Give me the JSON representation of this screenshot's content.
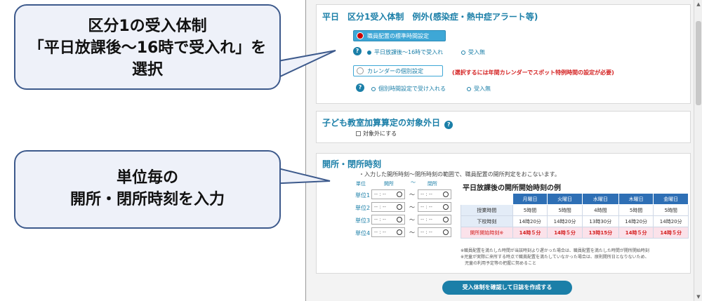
{
  "callouts": [
    {
      "lines": [
        "区分1の受入体制",
        "「平日放課後～16時で受入れ」を",
        "選択"
      ]
    },
    {
      "lines": [
        "単位毎の",
        "開所・閉所時刻を入力"
      ]
    }
  ],
  "panel1": {
    "title": "平日　区分1受入体制　例外(感染症・熱中症アラート等)",
    "standard_button": "職員配置の標準時間設定",
    "standard_options": [
      "平日放課後～16時で受入れ",
      "受入無"
    ],
    "standard_selected": 0,
    "calendar_button": "カレンダーの個別設定",
    "warning": "(選択するには年間カレンダーでスポット特例時間の設定が必要)",
    "calendar_options": [
      "個別時間設定で受け入れる",
      "受入無"
    ],
    "help": "?"
  },
  "panel2": {
    "title": "子ども教室加算算定の対象外日",
    "help": "?",
    "checkbox_label": "対象外にする"
  },
  "panel3": {
    "title": "開所・閉所時刻",
    "note": "・入力した開所時刻～閉所時刻の範囲で、職員配置の開所判定をおこないます。",
    "head_unit": "単位",
    "head_open": "開所",
    "head_sep": "～",
    "head_close": "閉所",
    "units": [
      "単位1",
      "単位2",
      "単位3",
      "単位4"
    ],
    "time_placeholder": "-- : --",
    "example_title": "平日放課後の開所開始時刻の例",
    "example_headers": [
      "",
      "月曜日",
      "火曜日",
      "水曜日",
      "木曜日",
      "金曜日"
    ],
    "example_rows": [
      {
        "label": "授業時間",
        "values": [
          "5時間",
          "5時間",
          "4時間",
          "5時間",
          "5時間"
        ]
      },
      {
        "label": "下校時刻",
        "values": [
          "14時20分",
          "14時20分",
          "13時30分",
          "14時20分",
          "14時20分"
        ]
      },
      {
        "label": "開所開始時刻※",
        "values": [
          "14時５分",
          "14時５分",
          "13時15分",
          "14時５分",
          "14時５分"
        ]
      }
    ],
    "footnotes": [
      "※職員配置を満たした時間が当該時刻より遅かった場合は、職員配置を満たした時間が開所開始時刻",
      "※児童が実際に来所する時点で職員配置を満たしていなかった場合は、原則開所日となりないため、",
      "　児童の利用予定等の把握に努めること"
    ]
  },
  "submit_label": "受入体制を確認して日誌を作成する",
  "colors": {
    "accent": "#1b7fa8",
    "button": "#3ea7d6",
    "warning": "#d42020",
    "table_header": "#2e6fb5",
    "callout_border": "#3d5a8c"
  }
}
